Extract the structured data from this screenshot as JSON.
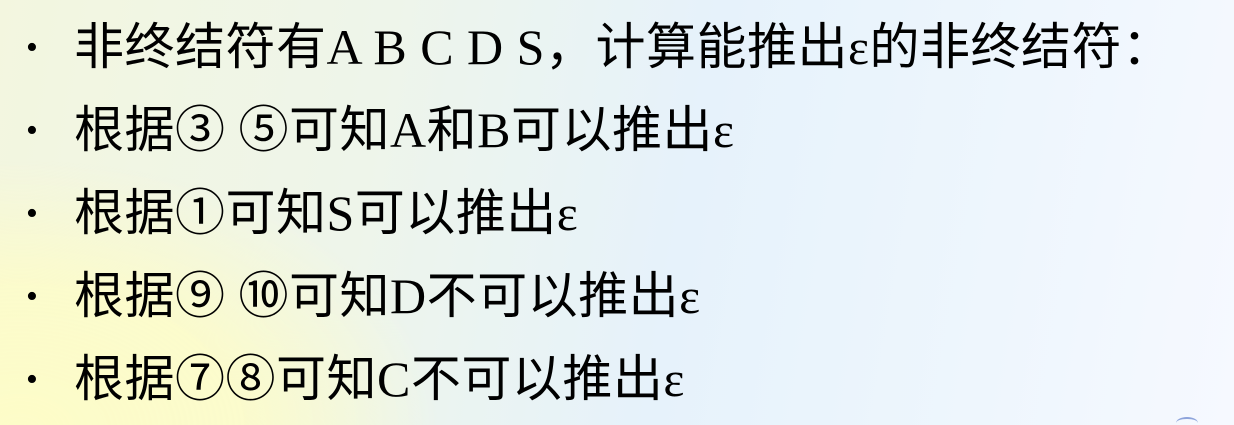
{
  "slide": {
    "bullet_symbol": "•",
    "items": [
      {
        "text": "非终结符有A B C D S，计算能推出ε的非终结符："
      },
      {
        "text": "根据③ ⑤可知A和B可以推出ε"
      },
      {
        "text": "根据①可知S可以推出ε"
      },
      {
        "text": "根据⑨ ⑩可知D不可以推出ε"
      },
      {
        "text": "根据⑦⑧可知C不可以推出ε"
      }
    ]
  },
  "colors": {
    "text": "#000000",
    "background_left": "#fdfcc8",
    "background_right": "#e6f2fb"
  }
}
